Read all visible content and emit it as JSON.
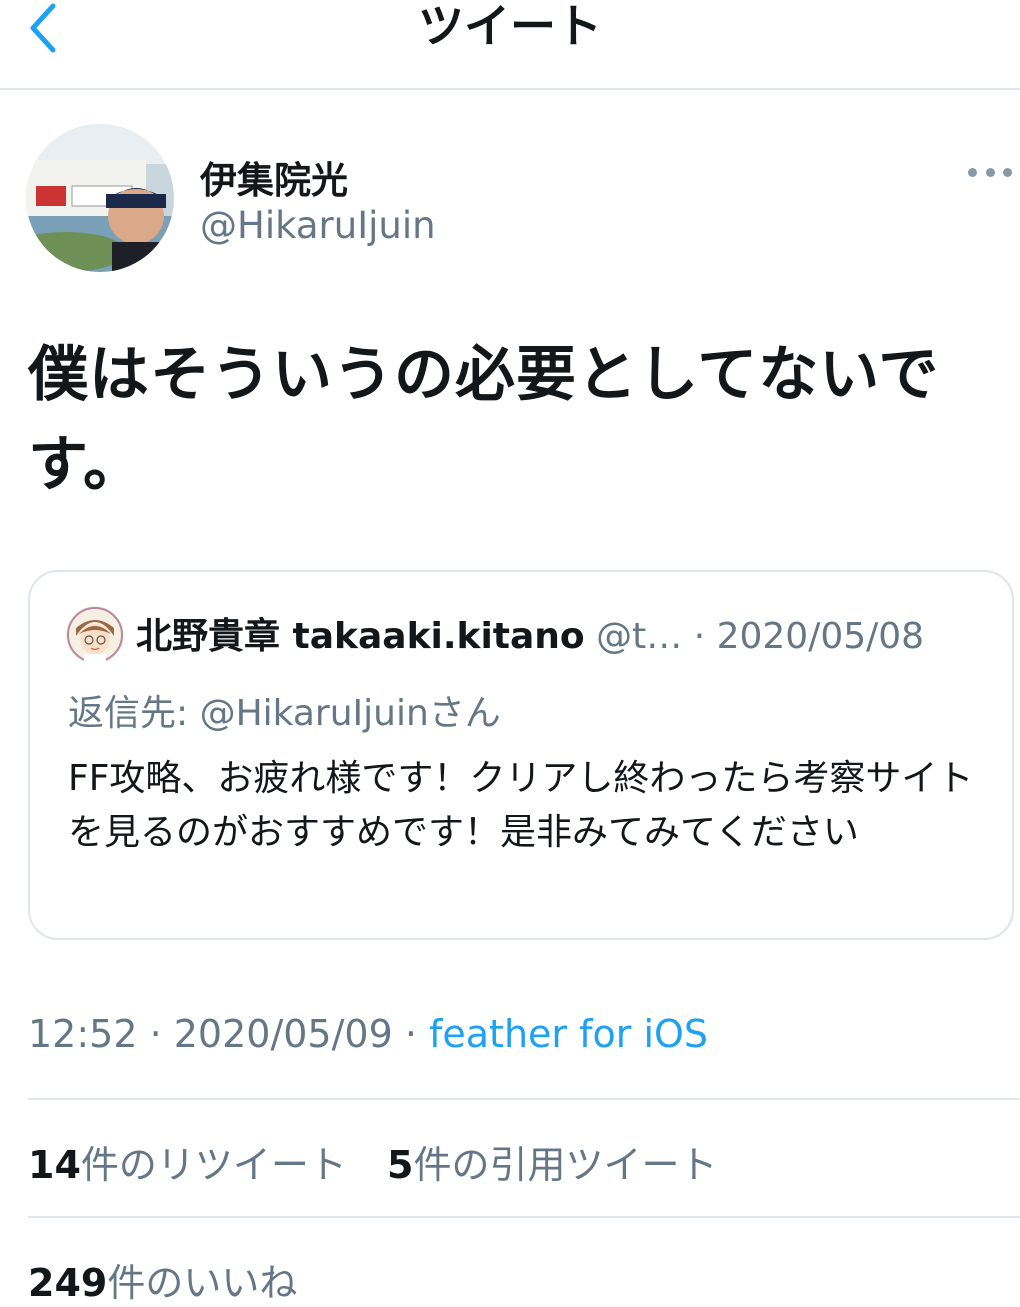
{
  "header": {
    "title": "ツイート"
  },
  "icons": {
    "back": "chevron-left-icon",
    "more": "more-horizontal-icon"
  },
  "tweet": {
    "display_name": "伊集院光",
    "handle": "@HikaruIjuin",
    "text": "僕はそういうの必要としてないです。",
    "timestamp": "12:52 · 2020/05/09 · ",
    "source": "feather for iOS"
  },
  "quoted": {
    "display_name": "北野貴章 takaaki.kitano",
    "handle": "@t…",
    "date": " · 2020/05/08",
    "reply_prefix": "返信先: ",
    "reply_user": "@HikaruIjuinさん",
    "text": "FF攻略、お疲れ様です！クリアし終わったら考察サイトを見るのがおすすめです！是非みてみてください"
  },
  "stats": {
    "retweets_count": "14",
    "retweets_label": "件のリツイート",
    "quotes_count": "5",
    "quotes_label": "件の引用ツイート",
    "likes_count": "249",
    "likes_label": "件のいいね"
  },
  "colors": {
    "text": "#14171a",
    "secondary": "#657786",
    "accent": "#1da1f2",
    "divider": "#e1e6ea"
  }
}
